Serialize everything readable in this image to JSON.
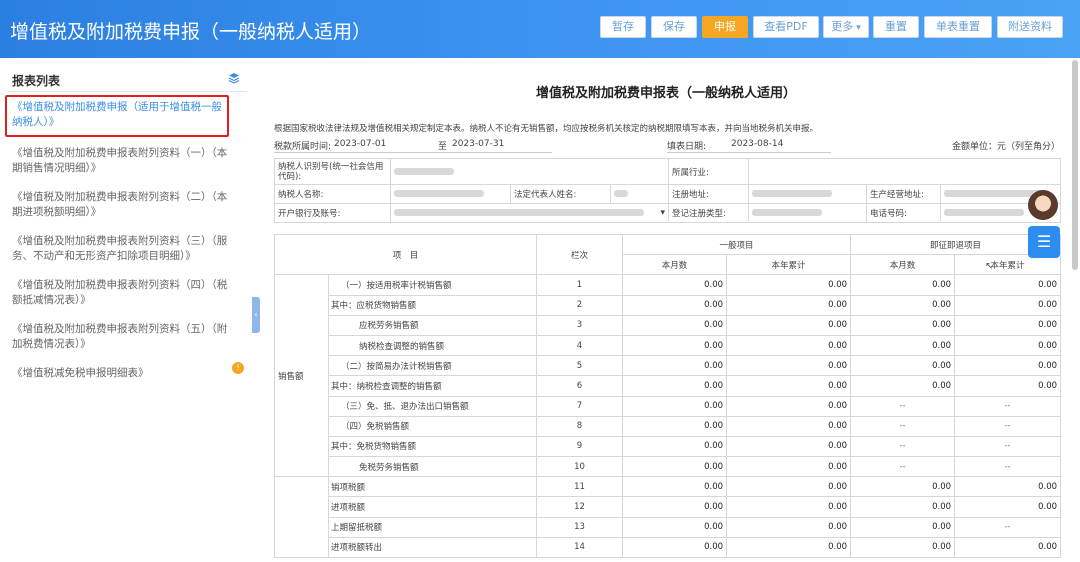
{
  "header": {
    "title": "增值税及附加税费申报（一般纳税人适用）",
    "buttons": {
      "save_draft": "暂存",
      "save": "保存",
      "declare": "申报",
      "view_pdf": "查看PDF",
      "more": "更多",
      "reset": "重置",
      "single_reset": "单表重置",
      "attachments": "附送资料"
    }
  },
  "sidebar": {
    "title": "报表列表",
    "items": [
      "《增值税及附加税费申报（适用于增值税一般纳税人）》",
      "《增值税及附加税费申报表附列资料（一）（本期销售情况明细）》",
      "《增值税及附加税费申报表附列资料（二）（本期进项税额明细）》",
      "《增值税及附加税费申报表附列资料（三）（服务、不动产和无形资产扣除项目明细）》",
      "《增值税及附加税费申报表附列资料（四）（税额抵减情况表）》",
      "《增值税及附加税费申报表附列资料（五）（附加税费情况表）》",
      "《增值税减免税申报明细表》"
    ],
    "badge": "!"
  },
  "form": {
    "title": "增值税及附加税费申报表（一般纳税人适用）",
    "note": "根据国家税收法律法规及增值税相关规定制定本表。纳税人不论有无销售额，均应按税务机关核定的纳税期限填写本表，并向当地税务机关申报。",
    "period_label": "税款所属时间:",
    "period_from": "2023-07-01",
    "period_to_label": "至",
    "period_to": "2023-07-31",
    "fill_date_label": "填表日期:",
    "fill_date": "2023-08-14",
    "unit": "金额单位：元（列至角分）"
  },
  "info": {
    "taxpayer_id": "纳税人识别号(统一社会信用代码):",
    "industry": "所属行业:",
    "taxpayer_name": "纳税人名称:",
    "legal_rep": "法定代表人姓名:",
    "reg_address": "注册地址:",
    "biz_address": "生产经营地址:",
    "bank": "开户银行及账号:",
    "reg_type": "登记注册类型:",
    "phone": "电话号码:"
  },
  "grid": {
    "headers": {
      "item": "项　目",
      "line_no": "栏次",
      "general": "一般项目",
      "immediate": "即征即退项目",
      "month": "本月数",
      "ytd": "本年累计"
    },
    "group_sales": "销售额",
    "rows": [
      {
        "label": "（一）按适用税率计税销售额",
        "no": "1",
        "v": [
          "0.00",
          "0.00",
          "0.00",
          "0.00"
        ]
      },
      {
        "label": "其中：应税货物销售额",
        "no": "2",
        "v": [
          "0.00",
          "0.00",
          "0.00",
          "0.00"
        ]
      },
      {
        "label": "应税劳务销售额",
        "no": "3",
        "v": [
          "0.00",
          "0.00",
          "0.00",
          "0.00"
        ]
      },
      {
        "label": "纳税检查调整的销售额",
        "no": "4",
        "v": [
          "0.00",
          "0.00",
          "0.00",
          "0.00"
        ]
      },
      {
        "label": "（二）按简易办法计税销售额",
        "no": "5",
        "v": [
          "0.00",
          "0.00",
          "0.00",
          "0.00"
        ]
      },
      {
        "label": "其中：纳税检查调整的销售额",
        "no": "6",
        "v": [
          "0.00",
          "0.00",
          "0.00",
          "0.00"
        ]
      },
      {
        "label": "（三）免、抵、退办法出口销售额",
        "no": "7",
        "v": [
          "0.00",
          "0.00",
          "--",
          "--"
        ]
      },
      {
        "label": "（四）免税销售额",
        "no": "8",
        "v": [
          "0.00",
          "0.00",
          "--",
          "--"
        ]
      },
      {
        "label": "其中：免税货物销售额",
        "no": "9",
        "v": [
          "0.00",
          "0.00",
          "--",
          "--"
        ]
      },
      {
        "label": "免税劳务销售额",
        "no": "10",
        "v": [
          "0.00",
          "0.00",
          "--",
          "--"
        ]
      },
      {
        "label": "销项税额",
        "no": "11",
        "v": [
          "0.00",
          "0.00",
          "0.00",
          "0.00"
        ]
      },
      {
        "label": "进项税额",
        "no": "12",
        "v": [
          "0.00",
          "0.00",
          "0.00",
          "0.00"
        ]
      },
      {
        "label": "上期留抵税额",
        "no": "13",
        "v": [
          "0.00",
          "0.00",
          "0.00",
          "--"
        ]
      },
      {
        "label": "进项税额转出",
        "no": "14",
        "v": [
          "0.00",
          "0.00",
          "0.00",
          "0.00"
        ]
      }
    ]
  }
}
